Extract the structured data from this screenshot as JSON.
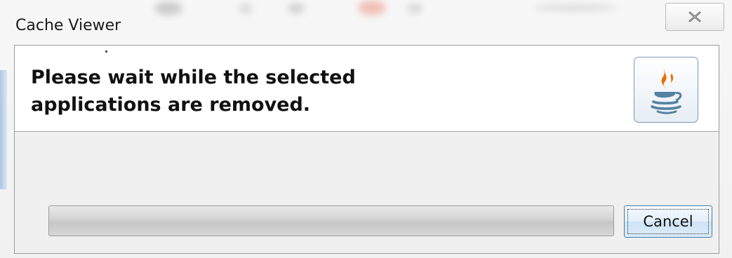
{
  "window": {
    "title": "Cache Viewer"
  },
  "header": {
    "message": "Please wait while the selected applications are removed.",
    "logo_icon": "java-icon"
  },
  "progress": {
    "fraction": 0.0
  },
  "buttons": {
    "cancel_label": "Cancel",
    "close_icon": "close-icon"
  },
  "colors": {
    "accent_border": "#3c7fb1",
    "java_orange": "#e76f00",
    "java_blue": "#5382a1"
  }
}
